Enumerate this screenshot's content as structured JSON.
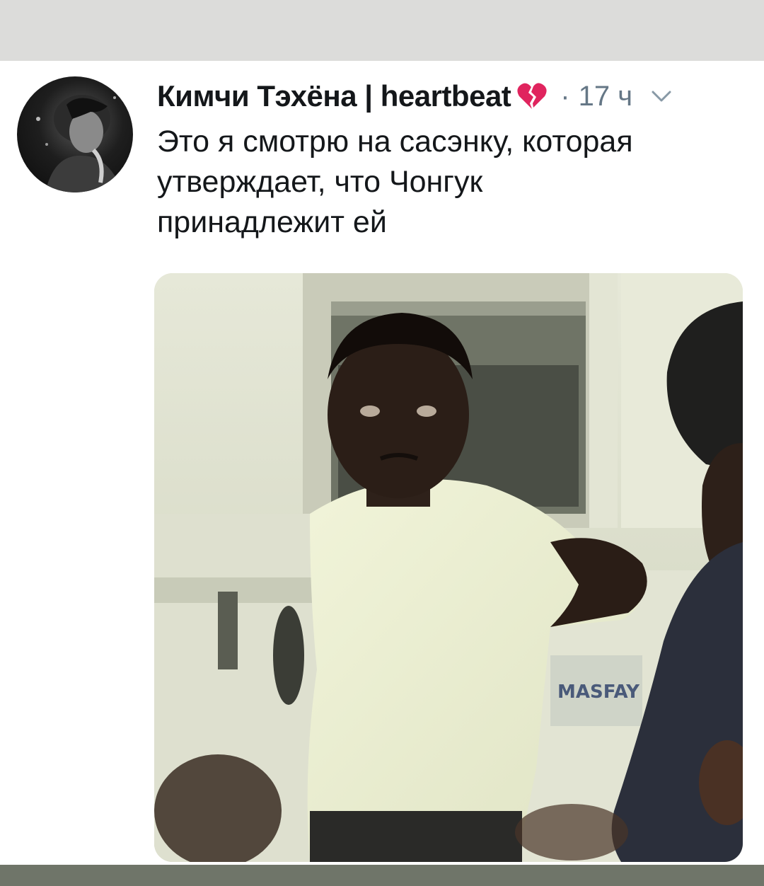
{
  "tweet": {
    "author_name": "Кимчи Тэхёна | heartbeat",
    "separator": "·",
    "timestamp": "17 ч",
    "text_lines": [
      "Это я смотрю на сасэнку, которая",
      "утверждает, что Чонгук",
      "принадлежит ей"
    ],
    "media_caption": "MASFAY"
  },
  "icons": {
    "heart": "broken-heart-icon",
    "menu": "chevron-down-icon"
  },
  "colors": {
    "name": "#14171a",
    "meta": "#657786",
    "heart": "#e0245e",
    "top_bar": "#dcdcda",
    "bottom_bar": "#6f7569"
  }
}
